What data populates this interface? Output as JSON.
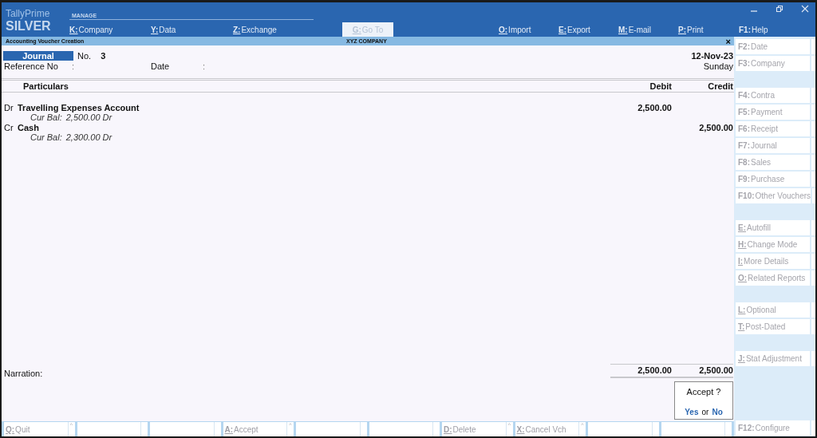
{
  "app": {
    "brand": "TallyPrime",
    "edition": "SILVER"
  },
  "menu": {
    "section": "MANAGE",
    "items": [
      {
        "key": "K:",
        "label": "Company",
        "underlined": true,
        "kind": "menu",
        "disabled": false
      },
      {
        "key": "Y:",
        "label": "Data",
        "underlined": true,
        "kind": "menu",
        "disabled": false
      },
      {
        "key": "Z:",
        "label": "Exchange",
        "underlined": true,
        "kind": "menu",
        "disabled": false
      },
      {
        "key": "G:",
        "label": "Go To",
        "underlined": true,
        "kind": "button",
        "disabled": true
      },
      {
        "key": "O:",
        "label": "Import",
        "underlined": true,
        "kind": "menu",
        "disabled": false
      },
      {
        "key": "E:",
        "label": "Export",
        "underlined": true,
        "kind": "menu",
        "disabled": false
      },
      {
        "key": "M:",
        "label": "E-mail",
        "underlined": true,
        "kind": "menu",
        "disabled": false
      },
      {
        "key": "P:",
        "label": "Print",
        "underlined": true,
        "kind": "menu",
        "disabled": false
      },
      {
        "key": "F1:",
        "label": "Help",
        "underlined": false,
        "kind": "menu",
        "disabled": false
      }
    ]
  },
  "title_bar": {
    "title": "Accounting Voucher Creation",
    "company": "XYZ COMPANY",
    "close": "×"
  },
  "voucher": {
    "type": "Journal",
    "no_label": "No.",
    "number": "3",
    "date": "12-Nov-23",
    "day": "Sunday",
    "reference_label": "Reference No",
    "reference_sep": ":",
    "date_label": "Date",
    "date_sep": ":"
  },
  "table": {
    "columns": [
      "Particulars",
      "Debit",
      "Credit"
    ],
    "rows": [
      {
        "side": "Dr",
        "account": "Travelling Expenses Account",
        "balance_label": "Cur Bal:",
        "balance": "2,500.00 Dr",
        "debit": "2,500.00"
      },
      {
        "side": "Cr",
        "account": "Cash",
        "balance_label": "Cur Bal:",
        "balance": "2,300.00 Dr",
        "credit": "2,500.00"
      }
    ],
    "narration_label": "Narration:",
    "total_debit": "2,500.00",
    "total_credit": "2,500.00"
  },
  "dialog": {
    "prompt": "Accept ?",
    "yes": "Yes",
    "or": "or",
    "no": "No"
  },
  "bottom_bar": [
    {
      "kind": "key",
      "key": "Q:",
      "label": "Quit",
      "hint": "^"
    },
    {
      "kind": "blank"
    },
    {
      "kind": "blank"
    },
    {
      "kind": "key",
      "key": "A:",
      "label": "Accept",
      "hint": "^"
    },
    {
      "kind": "blank"
    },
    {
      "kind": "blank"
    },
    {
      "kind": "key",
      "key": "D:",
      "label": "Delete",
      "hint": "^"
    },
    {
      "kind": "key",
      "key": "X:",
      "label": "Cancel Vch",
      "hint": "^"
    },
    {
      "kind": "blank"
    },
    {
      "kind": "blank"
    }
  ],
  "side_panel": {
    "groups": [
      [
        {
          "key": "F2:",
          "label": "Date",
          "underlined": false
        },
        {
          "key": "F3:",
          "label": "Company",
          "underlined": false
        }
      ],
      [
        {
          "key": "F4:",
          "label": "Contra",
          "underlined": false
        },
        {
          "key": "F5:",
          "label": "Payment",
          "underlined": false
        },
        {
          "key": "F6:",
          "label": "Receipt",
          "underlined": false
        },
        {
          "key": "F7:",
          "label": "Journal",
          "underlined": false
        },
        {
          "key": "F8:",
          "label": "Sales",
          "underlined": false
        },
        {
          "key": "F9:",
          "label": "Purchase",
          "underlined": false
        },
        {
          "key": "F10:",
          "label": "Other Vouchers",
          "underlined": false
        }
      ],
      [
        {
          "key": "E:",
          "label": "Autofill",
          "underlined": true
        },
        {
          "key": "H:",
          "label": "Change Mode",
          "underlined": true
        },
        {
          "key": "I:",
          "label": "More Details",
          "underlined": true
        },
        {
          "key": "O:",
          "label": "Related Reports",
          "underlined": true
        }
      ],
      [
        {
          "key": "L:",
          "label": "Optional",
          "underlined": true
        },
        {
          "key": "T:",
          "label": "Post-Dated",
          "underlined": true
        }
      ],
      [
        {
          "key": "J:",
          "label": "Stat Adjustment",
          "underlined": true
        }
      ]
    ],
    "footer": {
      "key": "F12:",
      "label": "Configure",
      "underlined": false
    }
  }
}
